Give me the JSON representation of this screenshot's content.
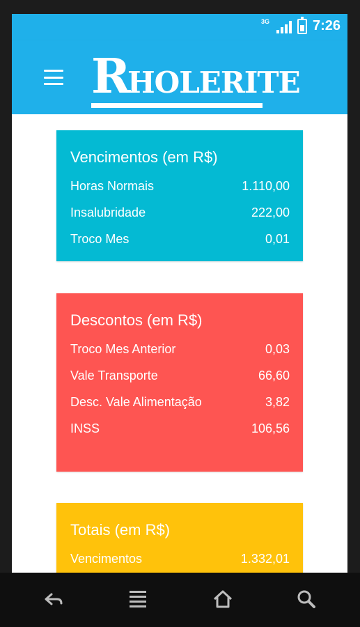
{
  "status_bar": {
    "network": "3G",
    "time": "7:26"
  },
  "app_bar": {
    "logo_r": "R",
    "logo_rest": "HOLERITE",
    "menu_icon": "hamburger-menu-icon"
  },
  "colors": {
    "primary": "#1fb0ea",
    "vencimentos": "#04bad3",
    "descontos": "#fe5552",
    "totais": "#ffc20b"
  },
  "vencimentos": {
    "title": "Vencimentos (em R$)",
    "items": [
      {
        "label": "Horas Normais",
        "value": "1.110,00"
      },
      {
        "label": "Insalubridade",
        "value": "222,00"
      },
      {
        "label": "Troco Mes",
        "value": "0,01"
      }
    ]
  },
  "descontos": {
    "title": "Descontos (em R$)",
    "items": [
      {
        "label": "Troco Mes Anterior",
        "value": "0,03"
      },
      {
        "label": "Vale Transporte",
        "value": "66,60"
      },
      {
        "label": "Desc. Vale Alimentação",
        "value": "3,82"
      },
      {
        "label": "INSS",
        "value": "106,56"
      }
    ]
  },
  "totais": {
    "title": "Totais (em R$)",
    "items": [
      {
        "label": "Vencimentos",
        "value": "1.332,01"
      }
    ]
  },
  "nav_bar": {
    "icons": [
      "back-icon",
      "recent-apps-icon",
      "home-icon",
      "search-icon"
    ]
  }
}
